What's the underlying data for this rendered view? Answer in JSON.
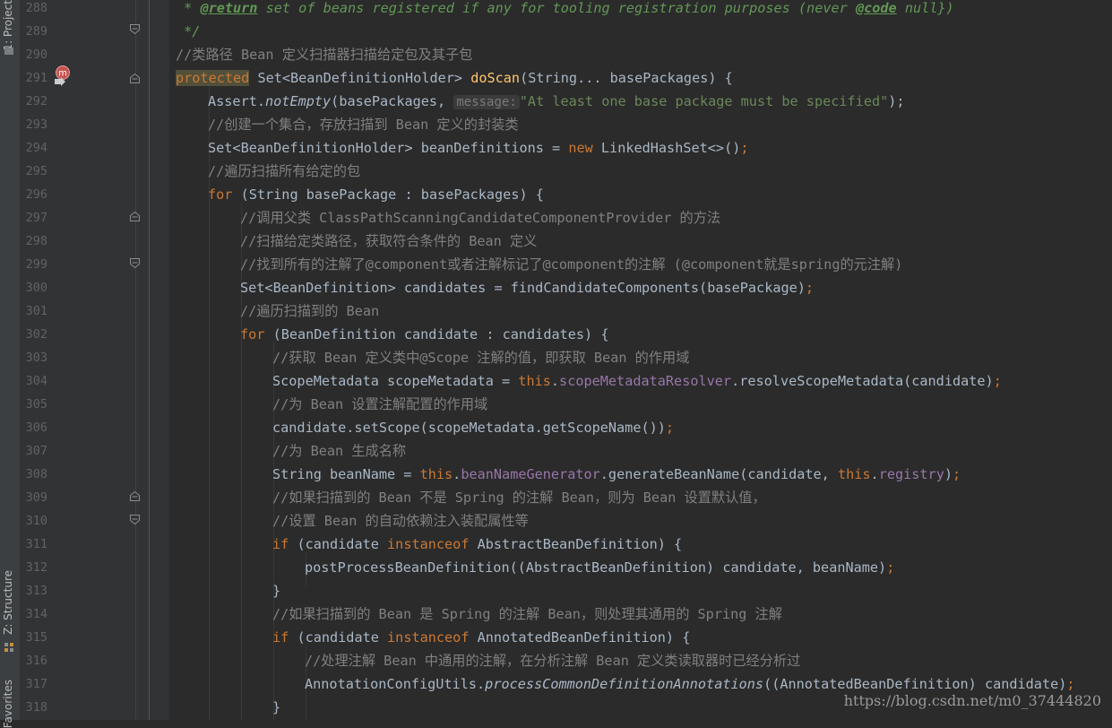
{
  "tool_windows": {
    "project_tab": "1: Project",
    "structure_tab": "Z: Structure",
    "favorites_tab": "Favorites"
  },
  "line_numbers": [
    "288",
    "289",
    "290",
    "291",
    "292",
    "293",
    "294",
    "295",
    "296",
    "297",
    "298",
    "299",
    "300",
    "301",
    "302",
    "303",
    "304",
    "305",
    "306",
    "307",
    "308",
    "309",
    "310",
    "311",
    "312",
    "313",
    "314",
    "315",
    "316",
    "317",
    "318"
  ],
  "code": {
    "l288": {
      "star": " * ",
      "tag": "@return",
      "text": " set of beans registered if any for tooling registration purposes (never ",
      "code_tag": "@code",
      "text2": " null})"
    },
    "l289": " */",
    "l290": "//类路径 Bean 定义扫描器扫描给定包及其子包",
    "l291": {
      "kw": "protected",
      "type": " Set<BeanDefinitionHolder> ",
      "method": "doScan",
      "params": "(String... basePackages) {"
    },
    "l292": {
      "cls": "Assert.",
      "method": "notEmpty",
      "args": "(basePackages,",
      "hint": "message:",
      "str": "\"At least one base package must be specified\"",
      "end": ");"
    },
    "l293": "//创建一个集合，存放扫描到 Bean 定义的封装类",
    "l294": {
      "decl": "Set<BeanDefinitionHolder> beanDefinitions = ",
      "kw": "new",
      "rest": " LinkedHashSet<>()",
      ";": ";"
    },
    "l295": "//遍历扫描所有给定的包",
    "l296": {
      "kw": "for",
      "rest": " (String basePackage : basePackages) {"
    },
    "l297": "//调用父类 ClassPathScanningCandidateComponentProvider 的方法",
    "l298": "//扫描给定类路径，获取符合条件的 Bean 定义",
    "l299": "//找到所有的注解了@component或者注解标记了@component的注解 (@component就是spring的元注解)",
    "l300": {
      "text": "Set<BeanDefinition> candidates = findCandidateComponents(basePackage)",
      "semi": ";"
    },
    "l301": "//遍历扫描到的 Bean",
    "l302": {
      "kw": "for",
      "rest": " (BeanDefinition candidate : candidates) {"
    },
    "l303": "//获取 Bean 定义类中@Scope 注解的值，即获取 Bean 的作用域",
    "l304": {
      "a": "ScopeMetadata scopeMetadata = ",
      "kw": "this",
      "dot": ".",
      "field": "scopeMetadataResolver",
      "b": ".resolveScopeMetadata(candidate)",
      "semi": ";"
    },
    "l305": "//为 Bean 设置注解配置的作用域",
    "l306": {
      "text": "candidate.setScope(scopeMetadata.getScopeName())",
      "semi": ";"
    },
    "l307": "//为 Bean 生成名称",
    "l308": {
      "a": "String beanName = ",
      "kw": "this",
      "dot": ".",
      "field": "beanNameGenerator",
      "b": ".generateBeanName(candidate,",
      "kw2": " this",
      "dot2": ".",
      "field2": "registry",
      "c": ")",
      "semi": ";"
    },
    "l309": "//如果扫描到的 Bean 不是 Spring 的注解 Bean，则为 Bean 设置默认值，",
    "l310": "//设置 Bean 的自动依赖注入装配属性等",
    "l311": {
      "kw": "if",
      "a": " (candidate ",
      "kw2": "instanceof",
      "b": " AbstractBeanDefinition) {"
    },
    "l312": {
      "a": "postProcessBeanDefinition((AbstractBeanDefinition) candidate,",
      "b": " beanName)",
      "semi": ";"
    },
    "l313": "}",
    "l314": "//如果扫描到的 Bean 是 Spring 的注解 Bean，则处理其通用的 Spring 注解",
    "l315": {
      "kw": "if",
      "a": " (candidate ",
      "kw2": "instanceof",
      "b": " AnnotatedBeanDefinition) {"
    },
    "l316": "//处理注解 Bean 中通用的注解，在分析注解 Bean 定义类读取器时已经分析过",
    "l317": {
      "cls": "AnnotationConfigUtils.",
      "method": "processCommonDefinitionAnnotations",
      "rest": "((AnnotatedBeanDefinition) candidate)",
      "semi": ";"
    },
    "l318": "}"
  },
  "watermark": "https://blog.csdn.net/m0_37444820",
  "colors": {
    "background": "#2B2B2B",
    "gutter": "#313335",
    "keyword": "#CC7832",
    "method": "#FFC66D",
    "string": "#6A8759",
    "comment": "#808080",
    "field": "#9876AA",
    "text": "#A9B7C6"
  },
  "icons": [
    "method-override-icon",
    "breakpoint-arrow-icon",
    "fold-marker-icon"
  ]
}
